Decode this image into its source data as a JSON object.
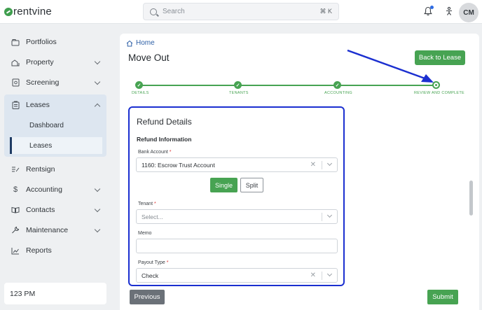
{
  "app": {
    "logo": "rentvine",
    "brand_color": "#3f9e4e",
    "accent_color": "#47a352",
    "highlight_color": "#1b2fd0"
  },
  "search": {
    "placeholder": "Search",
    "shortcut": "⌘ K"
  },
  "user": {
    "initials": "CM"
  },
  "sidebar": {
    "items": [
      {
        "label": "Portfolios",
        "icon": "portfolio-icon"
      },
      {
        "label": "Property",
        "icon": "house-icon"
      },
      {
        "label": "Screening",
        "icon": "screening-icon"
      },
      {
        "label": "Leases",
        "icon": "clipboard-icon"
      },
      {
        "label": "Rentsign",
        "icon": "sign-icon"
      },
      {
        "label": "Accounting",
        "icon": "dollar-icon"
      },
      {
        "label": "Contacts",
        "icon": "book-icon"
      },
      {
        "label": "Maintenance",
        "icon": "wrench-icon"
      },
      {
        "label": "Reports",
        "icon": "chart-icon"
      }
    ],
    "leases_sub": [
      "Dashboard",
      "Leases"
    ],
    "unit": "123 PM"
  },
  "main": {
    "breadcrumb": "Home",
    "title": "Move Out",
    "back_button": "Back to Lease",
    "steps": [
      "DETAILS",
      "TENANTS",
      "ACCOUNTING",
      "REVIEW AND COMPLETE"
    ],
    "refund": {
      "title": "Refund Details",
      "subtitle": "Refund Information",
      "bank_account_label": "Bank Account",
      "bank_account_value": "1160: Escrow Trust Account",
      "single_label": "Single",
      "split_label": "Split",
      "tenant_label": "Tenant",
      "tenant_placeholder": "Select...",
      "memo_label": "Memo",
      "payout_type_label": "Payout Type",
      "payout_type_value": "Check",
      "required_mark": "*"
    },
    "previous_button": "Previous",
    "submit_button": "Submit"
  }
}
